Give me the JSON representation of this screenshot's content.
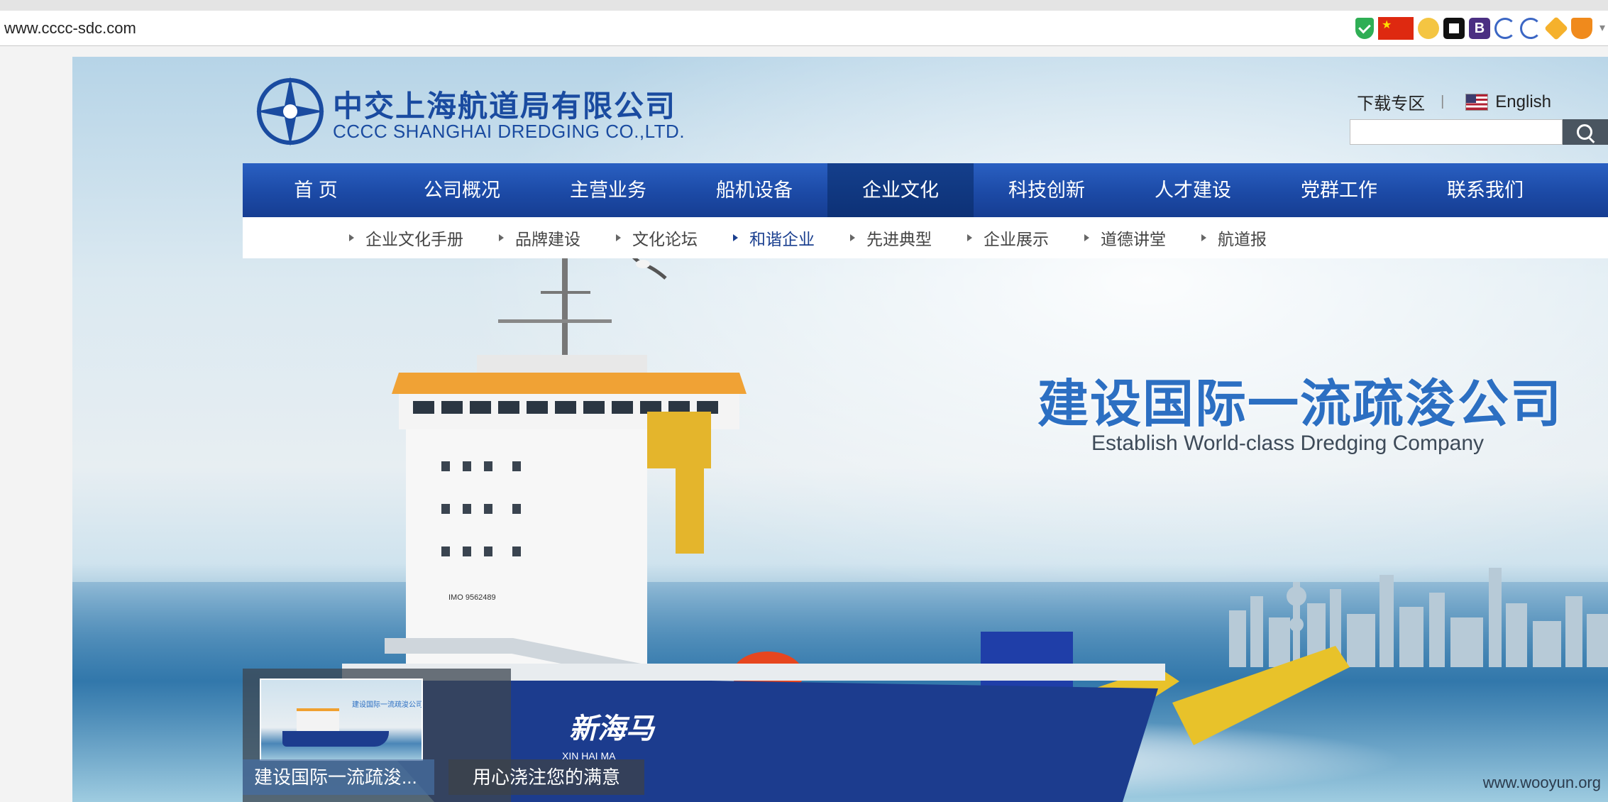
{
  "browser": {
    "url": "www.cccc-sdc.com",
    "extensions": [
      "shield-check-icon",
      "china-flag-icon",
      "wolf-icon",
      "panel-icon",
      "bold-b-icon",
      "wave-icon",
      "wave-icon",
      "box-icon",
      "cup-icon",
      "dropdown-arrow-icon"
    ]
  },
  "header": {
    "logo_cn": "中交上海航道局有限公司",
    "logo_en": "CCCC SHANGHAI DREDGING CO.,LTD.",
    "download": "下载专区",
    "divider": "|",
    "english": "English",
    "search_placeholder": ""
  },
  "nav": {
    "items": [
      {
        "label": "首 页"
      },
      {
        "label": "公司概况"
      },
      {
        "label": "主营业务"
      },
      {
        "label": "船机设备"
      },
      {
        "label": "企业文化"
      },
      {
        "label": "科技创新"
      },
      {
        "label": "人才建设"
      },
      {
        "label": "党群工作"
      },
      {
        "label": "联系我们"
      }
    ],
    "active_index": 4
  },
  "subnav": {
    "items": [
      {
        "label": "企业文化手册"
      },
      {
        "label": "品牌建设"
      },
      {
        "label": "文化论坛"
      },
      {
        "label": "和谐企业"
      },
      {
        "label": "先进典型"
      },
      {
        "label": "企业展示"
      },
      {
        "label": "道德讲堂"
      },
      {
        "label": "航道报"
      }
    ],
    "active_index": 3
  },
  "banner": {
    "slogan_cn": "建设国际一流疏浚公司",
    "slogan_en": "Establish World-class Dredging Company",
    "ship_name": "新海马",
    "ship_name_en": "XIN HAI MA",
    "imo": "IMO 9562489",
    "thumb_caption": "建设国际一流疏浚...",
    "tab2": "用心浇注您的满意",
    "thumb_text": "建设国际一流疏浚公司"
  },
  "watermark": "www.wooyun.org",
  "colors": {
    "nav_blue": "#1c4aa6",
    "nav_active": "#0d3176",
    "logo_blue": "#1a4ba0",
    "slogan_blue": "#2c6fc2",
    "hull_blue": "#1c3c8e"
  }
}
